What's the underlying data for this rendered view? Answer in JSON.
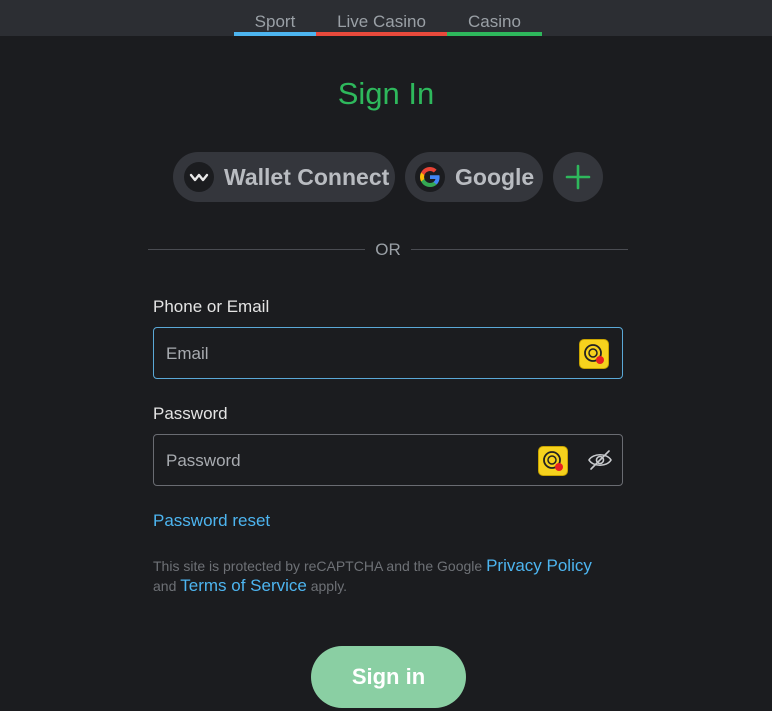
{
  "nav": {
    "tabs": [
      {
        "label": "Sport",
        "color": "#4db5f0"
      },
      {
        "label": "Live Casino",
        "color": "#e84a3c"
      },
      {
        "label": "Casino",
        "color": "#2eb85c"
      }
    ]
  },
  "form": {
    "title": "Sign In",
    "providers": {
      "wallet_label": "Wallet Connect",
      "google_label": "Google",
      "more_icon": "plus-icon"
    },
    "divider_text": "OR",
    "identifier": {
      "label": "Phone or Email",
      "placeholder": "Email",
      "value": ""
    },
    "password": {
      "label": "Password",
      "placeholder": "Password",
      "value": ""
    },
    "password_reset_label": "Password reset",
    "recaptcha": {
      "prefix": "This site is protected by reCAPTCHA and the Google",
      "privacy_label": "Privacy Policy",
      "and_text": "and",
      "terms_label": "Terms of Service",
      "suffix": "apply."
    },
    "submit_label": "Sign in"
  },
  "colors": {
    "accent_green": "#2eb85c",
    "link_blue": "#4db5f0",
    "submit_bg": "#8acfa3",
    "background": "#1b1c1f"
  }
}
